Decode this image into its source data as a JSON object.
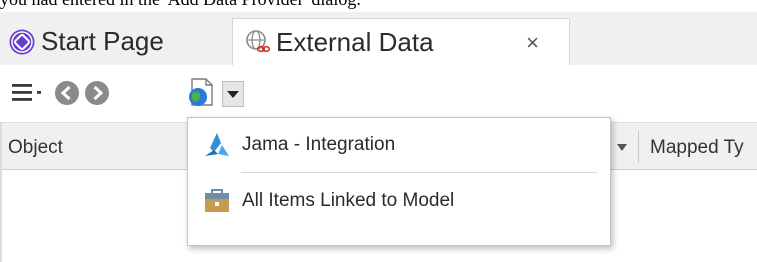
{
  "doc_text": "you had entered in the 'Add Data Provider' dialog.",
  "tabs": [
    {
      "label": "Start Page",
      "icon": "start-page-icon"
    },
    {
      "label": "External Data",
      "icon": "external-data-icon",
      "close": "×"
    }
  ],
  "toolbar": {
    "menu_icon": "hamburger-menu-icon",
    "back_icon": "back-arrow-icon",
    "forward_icon": "forward-arrow-icon",
    "provider_icon": "data-provider-icon",
    "dropdown_icon": "dropdown-arrow-icon"
  },
  "grid": {
    "columns": [
      {
        "label": "Object"
      },
      {
        "label": "Mapped Ty"
      }
    ]
  },
  "menu": {
    "items": [
      {
        "label": "Jama - Integration",
        "icon": "jama-logo-icon"
      },
      {
        "label": "All Items Linked to Model",
        "icon": "briefcase-icon"
      }
    ]
  },
  "colors": {
    "tab_bg": "#f0f0f0",
    "accent_blue": "#2b7bd6",
    "start_page_purple": "#6a3fc8",
    "nav_grey": "#8a8a8a"
  }
}
